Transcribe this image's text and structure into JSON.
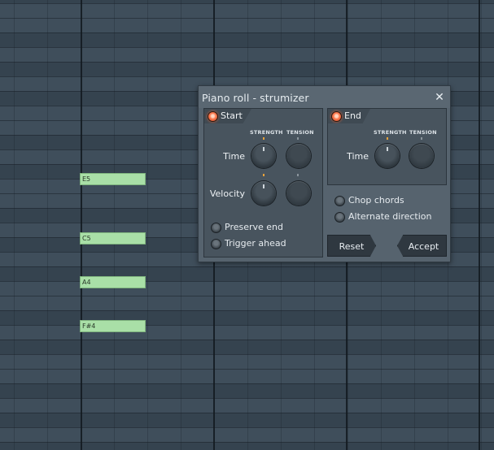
{
  "piano_roll": {
    "notes": [
      {
        "label": "E5"
      },
      {
        "label": "C5"
      },
      {
        "label": "A4"
      },
      {
        "label": "F#4"
      }
    ]
  },
  "dialog": {
    "title": "Piano roll - strumizer",
    "close_icon": "close-icon",
    "start": {
      "label": "Start",
      "col_strength": "STRENGTH",
      "col_tension": "TENSION",
      "row_time": "Time",
      "row_velocity": "Velocity",
      "preserve_end": "Preserve end",
      "trigger_ahead": "Trigger ahead"
    },
    "end": {
      "label": "End",
      "col_strength": "STRENGTH",
      "col_tension": "TENSION",
      "row_time": "Time"
    },
    "options": {
      "chop_chords": "Chop chords",
      "alternate_direction": "Alternate direction"
    },
    "buttons": {
      "reset": "Reset",
      "accept": "Accept"
    }
  },
  "colors": {
    "led_active": "#ff7a4f",
    "note_fill": "#a9dfa7",
    "tick_orange": "#e8a23a"
  }
}
